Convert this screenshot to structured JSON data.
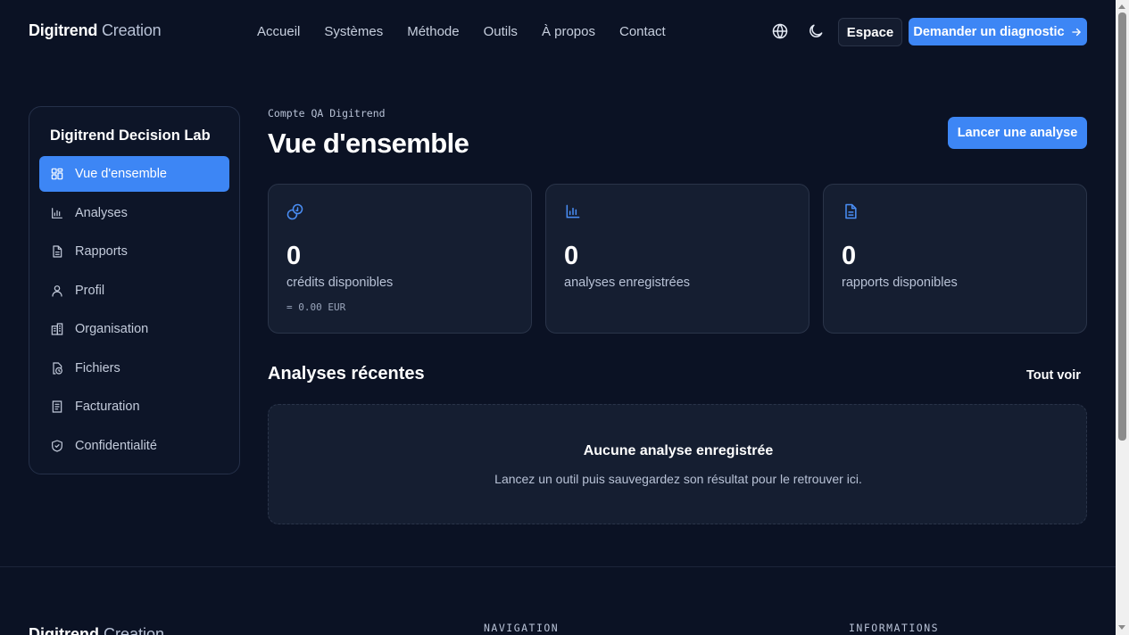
{
  "header": {
    "brand_bold": "Digitrend",
    "brand_light": " Creation",
    "nav": [
      "Accueil",
      "Systèmes",
      "Méthode",
      "Outils",
      "À propos",
      "Contact"
    ],
    "espace_label": "Espace",
    "diagnostic_label": "Demander un diagnostic"
  },
  "sidebar": {
    "title": "Digitrend Decision Lab",
    "items": [
      {
        "label": "Vue d'ensemble",
        "icon": "dashboard-icon",
        "active": true
      },
      {
        "label": "Analyses",
        "icon": "bar-chart-icon"
      },
      {
        "label": "Rapports",
        "icon": "document-icon"
      },
      {
        "label": "Profil",
        "icon": "user-icon"
      },
      {
        "label": "Organisation",
        "icon": "building-icon"
      },
      {
        "label": "Fichiers",
        "icon": "file-clock-icon"
      },
      {
        "label": "Facturation",
        "icon": "receipt-icon"
      },
      {
        "label": "Confidentialité",
        "icon": "shield-icon"
      }
    ]
  },
  "main": {
    "eyebrow": "Compte QA Digitrend",
    "title": "Vue d'ensemble",
    "launch_label": "Lancer une analyse",
    "stats": [
      {
        "value": "0",
        "label": "crédits disponibles",
        "sub": "= 0.00 EUR",
        "icon": "coins-icon"
      },
      {
        "value": "0",
        "label": "analyses enregistrées",
        "icon": "bar-chart-icon"
      },
      {
        "value": "0",
        "label": "rapports disponibles",
        "icon": "document-icon"
      }
    ],
    "recent_title": "Analyses récentes",
    "see_all": "Tout voir",
    "empty_title": "Aucune analyse enregistrée",
    "empty_desc": "Lancez un outil puis sauvegardez son résultat pour le retrouver ici."
  },
  "footer": {
    "brand_bold": "Digitrend",
    "brand_light": " Creation",
    "nav_heading": "NAVIGATION",
    "info_heading": "INFORMATIONS"
  },
  "colors": {
    "background": "#0b1224",
    "card": "#151e31",
    "accent": "#3d86f5"
  }
}
